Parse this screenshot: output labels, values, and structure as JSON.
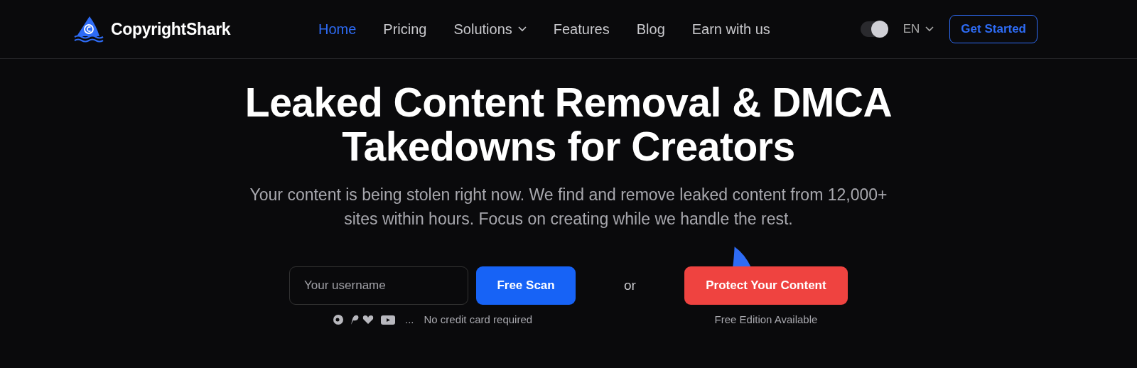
{
  "header": {
    "brand": "CopyrightShark",
    "nav": [
      {
        "label": "Home",
        "selected": true,
        "dropdown": false
      },
      {
        "label": "Pricing",
        "selected": false,
        "dropdown": false
      },
      {
        "label": "Solutions",
        "selected": false,
        "dropdown": true
      },
      {
        "label": "Features",
        "selected": false,
        "dropdown": false
      },
      {
        "label": "Blog",
        "selected": false,
        "dropdown": false
      },
      {
        "label": "Earn with us",
        "selected": false,
        "dropdown": false
      }
    ],
    "theme_toggle": {
      "on": true
    },
    "language": "EN",
    "cta": "Get Started"
  },
  "hero": {
    "title": "Leaked Content Removal & DMCA Takedowns for Creators",
    "subtitle": "Your content is being stolen right now. We find and remove leaked content from 12,000+ sites within hours. Focus on creating while we handle the rest.",
    "username_field": {
      "placeholder": "Your username"
    },
    "scan_button": "Free Scan",
    "platforms_more": "...",
    "scan_note": "No credit card required",
    "separator": "or",
    "protect_button": "Protect Your Content",
    "protect_note": "Free Edition Available"
  }
}
